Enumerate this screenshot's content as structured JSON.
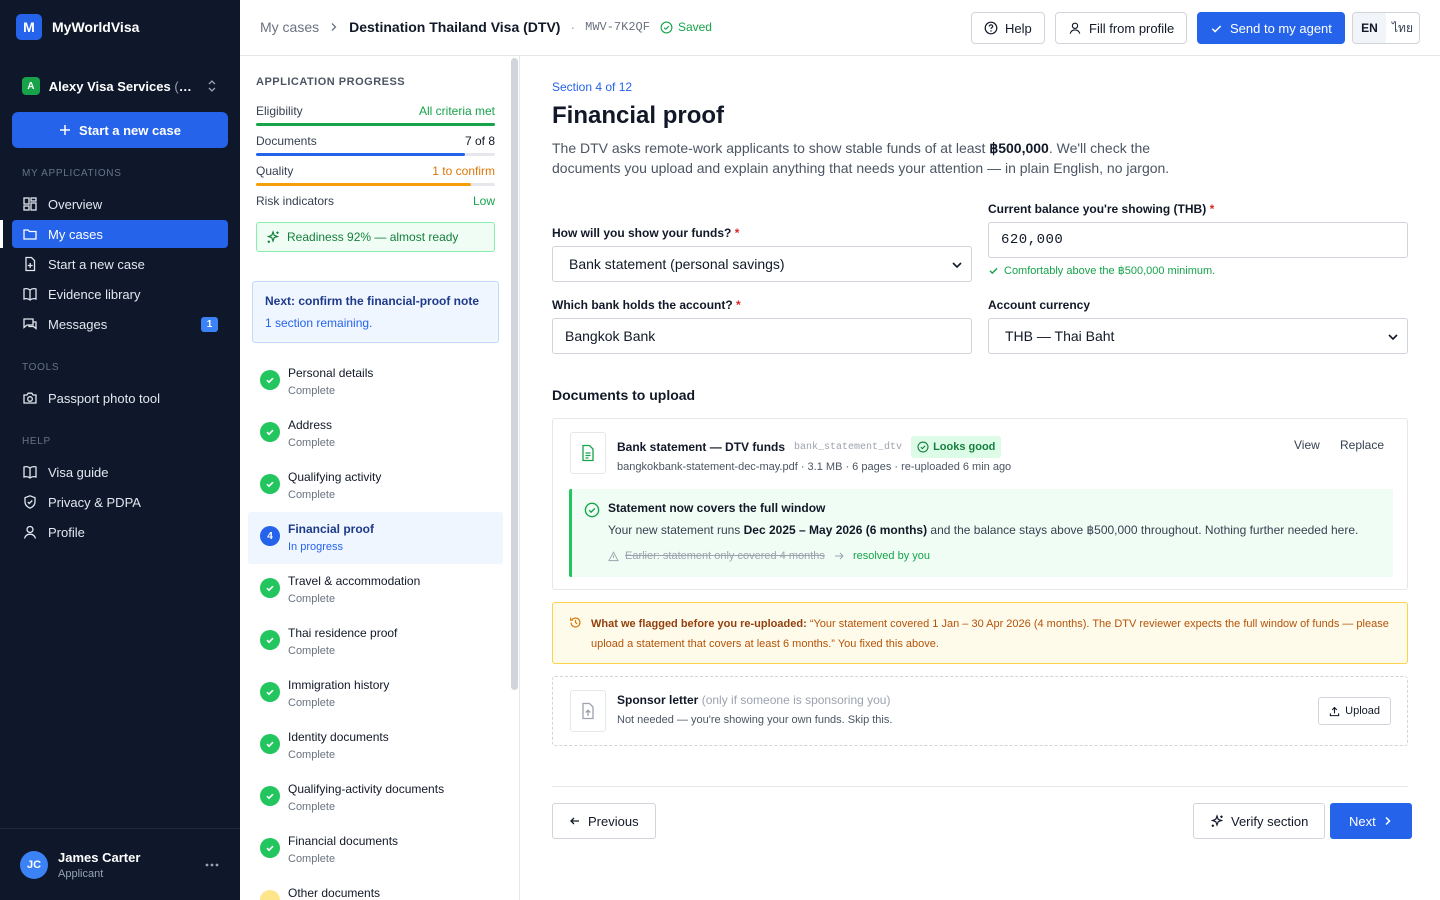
{
  "brand": {
    "logo_letter": "M",
    "name": "MyWorldVisa"
  },
  "agency": {
    "avatar": "A",
    "name": "Alexy Visa Services",
    "suffix": "(your agency)"
  },
  "sidebar": {
    "new_case_label": "Start a new case",
    "sections": {
      "applications": "My applications",
      "tools": "Tools",
      "help": "Help"
    },
    "items": [
      {
        "label": "Overview",
        "icon": "grid-icon"
      },
      {
        "label": "My cases",
        "icon": "folder-icon",
        "active": true
      },
      {
        "label": "Start a new case",
        "icon": "file-plus-icon"
      },
      {
        "label": "Evidence library",
        "icon": "book-icon"
      },
      {
        "label": "Messages",
        "icon": "message-icon",
        "badge": "1"
      },
      {
        "label": "Passport photo tool",
        "icon": "camera-icon"
      },
      {
        "label": "Visa guide",
        "icon": "book-open-icon"
      },
      {
        "label": "Privacy & PDPA",
        "icon": "shield-icon"
      },
      {
        "label": "Profile",
        "icon": "user-icon"
      }
    ],
    "user": {
      "initials": "JC",
      "name": "James Carter",
      "role": "Applicant"
    }
  },
  "header": {
    "crumb_root": "My cases",
    "crumb_current": "Destination Thailand Visa (DTV)",
    "case_code": "MWV-7K2QF",
    "saved": "Saved",
    "help": "Help",
    "fill": "Fill from profile",
    "send": "Send to my agent",
    "lang_en": "EN",
    "lang_th": "ไทย"
  },
  "progress": {
    "title": "Application progress",
    "rows": [
      {
        "label": "Eligibility",
        "value": "All criteria met",
        "fraction": 1.0,
        "color": "#16a34a"
      },
      {
        "label": "Documents",
        "value": "7 of 8",
        "fraction": 0.875,
        "color": "#2563eb"
      },
      {
        "label": "Quality",
        "value": "1 to confirm",
        "fraction": 0.9,
        "color": "#f59e0b"
      },
      {
        "label": "Risk indicators",
        "value": "Low",
        "color": "#16a34a"
      }
    ],
    "readiness": "Readiness 92% — almost ready",
    "next_title": "Next: confirm the financial-proof note",
    "next_sub": "1 section remaining."
  },
  "steps": [
    {
      "name": "Personal details",
      "status": "Complete"
    },
    {
      "name": "Address",
      "status": "Complete"
    },
    {
      "name": "Qualifying activity",
      "status": "Complete"
    },
    {
      "name": "Financial proof",
      "status": "In progress",
      "number": "4"
    },
    {
      "name": "Travel & accommodation",
      "status": "Complete"
    },
    {
      "name": "Thai residence proof",
      "status": "Complete"
    },
    {
      "name": "Immigration history",
      "status": "Complete"
    },
    {
      "name": "Identity documents",
      "status": "Complete"
    },
    {
      "name": "Qualifying-activity documents",
      "status": "Complete"
    },
    {
      "name": "Financial documents",
      "status": "Complete"
    },
    {
      "name": "Other documents",
      "status": ""
    }
  ],
  "main": {
    "section": "Section 4 of 12",
    "title": "Financial proof",
    "lead_a": "The DTV asks remote-work applicants to show stable funds of at least ",
    "lead_amount": "฿500,000",
    "lead_b": ". We'll check the documents you upload and explain anything that needs your attention — in plain English, no jargon.",
    "fields": {
      "method_label": "How will you show your funds?",
      "method_value": "Bank statement (personal savings)",
      "balance_label": "Current balance you're showing (THB)",
      "balance_value": "620,000",
      "balance_hint": "Comfortably above the ฿500,000 minimum.",
      "bank_label": "Which bank holds the account?",
      "bank_value": "Bangkok Bank",
      "currency_label": "Account currency",
      "currency_value": "THB — Thai Baht",
      "required_mark": "*"
    },
    "docs_heading": "Documents to upload",
    "doc1": {
      "name": "Bank statement — DTV funds",
      "key": "bank_statement_dtv",
      "badge": "Looks good",
      "meta": "bangkokbank-statement-dec-may.pdf · 3.1 MB · 6 pages · re-uploaded 6 min ago",
      "view": "View",
      "replace": "Replace",
      "resolved_title": "Statement now covers the full window",
      "resolved_a": "Your new statement runs ",
      "resolved_range": "Dec 2025 – May 2026 (6 months)",
      "resolved_b": " and the balance stays above ฿500,000 throughout. Nothing further needed here.",
      "earlier": "Earlier: statement only covered 4 months",
      "resolved_by": "resolved by you"
    },
    "flag": {
      "title": "What we flagged before you re-uploaded:",
      "text": "“Your statement covered 1 Jan – 30 Apr 2026 (4 months). The DTV reviewer expects the full window of funds — please upload a statement that covers at least 6 months.” You fixed this above."
    },
    "doc2": {
      "name": "Sponsor letter",
      "note": "(only if someone is sponsoring you)",
      "meta": "Not needed — you're showing your own funds. Skip this.",
      "upload": "Upload"
    },
    "footer": {
      "previous": "Previous",
      "verify": "Verify section",
      "next": "Next"
    }
  }
}
